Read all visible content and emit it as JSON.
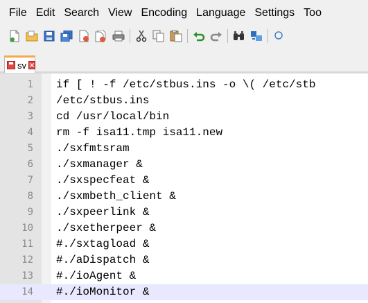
{
  "menubar": {
    "items": [
      "File",
      "Edit",
      "Search",
      "View",
      "Encoding",
      "Language",
      "Settings",
      "Too"
    ]
  },
  "toolbar": {
    "icons": [
      "new-file-icon",
      "open-file-icon",
      "save-icon",
      "save-all-icon",
      "close-icon",
      "close-all-icon",
      "print-icon",
      "cut-icon",
      "copy-icon",
      "paste-icon",
      "undo-icon",
      "redo-icon",
      "find-icon",
      "replace-icon",
      "zoom-icon"
    ]
  },
  "tab": {
    "label": "sv",
    "close_glyph": "×"
  },
  "editor": {
    "lines": [
      {
        "n": "1",
        "text": "if [ ! -f /etc/stbus.ins -o \\( /etc/stb"
      },
      {
        "n": "2",
        "text": "/etc/stbus.ins"
      },
      {
        "n": "3",
        "text": "cd /usr/local/bin"
      },
      {
        "n": "4",
        "text": "rm -f isa11.tmp isa11.new"
      },
      {
        "n": "5",
        "text": "./sxfmtsram"
      },
      {
        "n": "6",
        "text": "./sxmanager &"
      },
      {
        "n": "7",
        "text": "./sxspecfeat &"
      },
      {
        "n": "8",
        "text": "./sxmbeth_client &"
      },
      {
        "n": "9",
        "text": "./sxpeerlink &"
      },
      {
        "n": "10",
        "text": "./sxetherpeer &"
      },
      {
        "n": "11",
        "text": "#./sxtagload &"
      },
      {
        "n": "12",
        "text": "#./aDispatch &"
      },
      {
        "n": "13",
        "text": "#./ioAgent &"
      },
      {
        "n": "14",
        "text": "#./ioMonitor &"
      }
    ],
    "current_line": 14
  },
  "colors": {
    "tab_accent": "#f7a94b",
    "current_line": "#e8e8ff",
    "gutter": "#e4e4e4"
  }
}
